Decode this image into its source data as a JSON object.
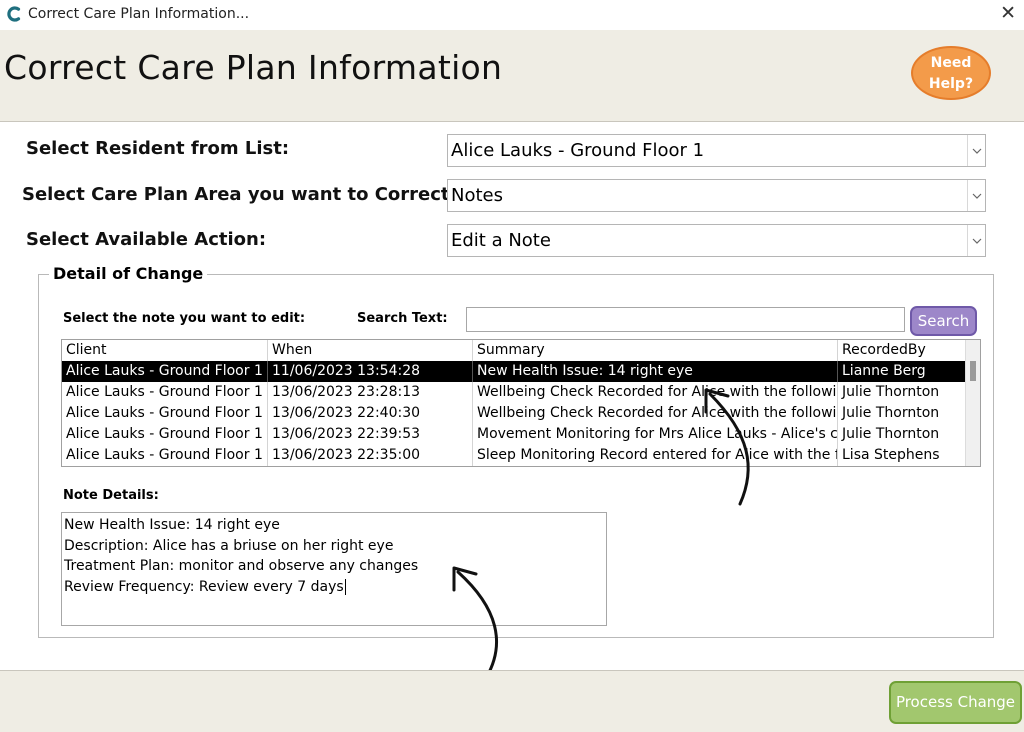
{
  "window": {
    "title": "Correct Care Plan Information...",
    "close_glyph": "✕"
  },
  "header": {
    "page_title": "Correct Care Plan Information",
    "help_line1": "Need",
    "help_line2": "Help?"
  },
  "form": {
    "resident_label": "Select Resident from List:",
    "resident_value": "Alice Lauks - Ground Floor 1",
    "area_label": "Select Care Plan Area you want to Correct:",
    "area_value": "Notes",
    "action_label": "Select Available Action:",
    "action_value": "Edit a Note"
  },
  "detail": {
    "legend": "Detail of Change",
    "select_note_label": "Select the note you want to edit:",
    "search_label": "Search Text:",
    "search_value": "",
    "search_button": "Search",
    "columns": [
      "Client",
      "When",
      "Summary",
      "RecordedBy"
    ],
    "rows": [
      [
        "Alice Lauks - Ground Floor 1",
        "11/06/2023 13:54:28",
        "New Health Issue: 14 right eye",
        "Lianne Berg"
      ],
      [
        "Alice Lauks - Ground Floor 1",
        "13/06/2023 23:28:13",
        "Wellbeing Check Recorded for Alice with the following",
        "Julie Thornton"
      ],
      [
        "Alice Lauks - Ground Floor 1",
        "13/06/2023 22:40:30",
        "Wellbeing Check Recorded for Alice with the following",
        "Julie Thornton"
      ],
      [
        "Alice Lauks - Ground Floor 1",
        "13/06/2023 22:39:53",
        "Movement Monitoring for Mrs Alice Lauks - Alice's cu",
        "Julie Thornton"
      ],
      [
        "Alice Lauks - Ground Floor 1",
        "13/06/2023 22:35:00",
        "Sleep Monitoring Record entered for Alice with the fol",
        "Lisa Stephens"
      ]
    ],
    "selected_row": 0,
    "note_details_label": "Note Details:",
    "note_lines": [
      "New Health Issue: 14 right eye",
      "Description: Alice has a briuse on her right eye",
      "Treatment Plan: monitor and observe any changes",
      "Review Frequency: Review every 7 days"
    ]
  },
  "footer": {
    "process_button": "Process Change"
  },
  "colors": {
    "header_bg": "#efede4",
    "help_orange": "#f39b4a",
    "search_purple": "#9d87c9",
    "process_green": "#a2c76e",
    "selected_row": "#000000"
  }
}
